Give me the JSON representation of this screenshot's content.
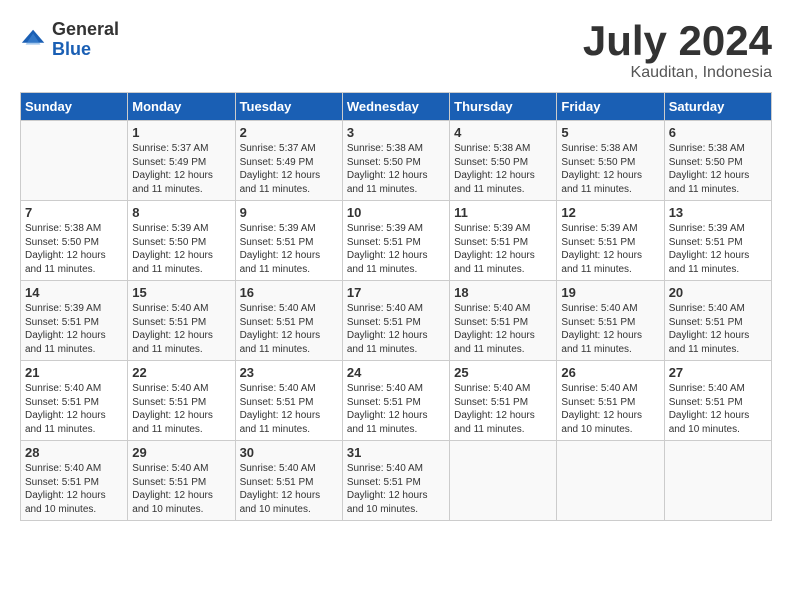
{
  "header": {
    "logo_general": "General",
    "logo_blue": "Blue",
    "month_title": "July 2024",
    "location": "Kauditan, Indonesia"
  },
  "days_of_week": [
    "Sunday",
    "Monday",
    "Tuesday",
    "Wednesday",
    "Thursday",
    "Friday",
    "Saturday"
  ],
  "weeks": [
    [
      {
        "day": "",
        "info": ""
      },
      {
        "day": "1",
        "info": "Sunrise: 5:37 AM\nSunset: 5:49 PM\nDaylight: 12 hours\nand 11 minutes."
      },
      {
        "day": "2",
        "info": "Sunrise: 5:37 AM\nSunset: 5:49 PM\nDaylight: 12 hours\nand 11 minutes."
      },
      {
        "day": "3",
        "info": "Sunrise: 5:38 AM\nSunset: 5:50 PM\nDaylight: 12 hours\nand 11 minutes."
      },
      {
        "day": "4",
        "info": "Sunrise: 5:38 AM\nSunset: 5:50 PM\nDaylight: 12 hours\nand 11 minutes."
      },
      {
        "day": "5",
        "info": "Sunrise: 5:38 AM\nSunset: 5:50 PM\nDaylight: 12 hours\nand 11 minutes."
      },
      {
        "day": "6",
        "info": "Sunrise: 5:38 AM\nSunset: 5:50 PM\nDaylight: 12 hours\nand 11 minutes."
      }
    ],
    [
      {
        "day": "7",
        "info": "Sunrise: 5:38 AM\nSunset: 5:50 PM\nDaylight: 12 hours\nand 11 minutes."
      },
      {
        "day": "8",
        "info": "Sunrise: 5:39 AM\nSunset: 5:50 PM\nDaylight: 12 hours\nand 11 minutes."
      },
      {
        "day": "9",
        "info": "Sunrise: 5:39 AM\nSunset: 5:51 PM\nDaylight: 12 hours\nand 11 minutes."
      },
      {
        "day": "10",
        "info": "Sunrise: 5:39 AM\nSunset: 5:51 PM\nDaylight: 12 hours\nand 11 minutes."
      },
      {
        "day": "11",
        "info": "Sunrise: 5:39 AM\nSunset: 5:51 PM\nDaylight: 12 hours\nand 11 minutes."
      },
      {
        "day": "12",
        "info": "Sunrise: 5:39 AM\nSunset: 5:51 PM\nDaylight: 12 hours\nand 11 minutes."
      },
      {
        "day": "13",
        "info": "Sunrise: 5:39 AM\nSunset: 5:51 PM\nDaylight: 12 hours\nand 11 minutes."
      }
    ],
    [
      {
        "day": "14",
        "info": "Sunrise: 5:39 AM\nSunset: 5:51 PM\nDaylight: 12 hours\nand 11 minutes."
      },
      {
        "day": "15",
        "info": "Sunrise: 5:40 AM\nSunset: 5:51 PM\nDaylight: 12 hours\nand 11 minutes."
      },
      {
        "day": "16",
        "info": "Sunrise: 5:40 AM\nSunset: 5:51 PM\nDaylight: 12 hours\nand 11 minutes."
      },
      {
        "day": "17",
        "info": "Sunrise: 5:40 AM\nSunset: 5:51 PM\nDaylight: 12 hours\nand 11 minutes."
      },
      {
        "day": "18",
        "info": "Sunrise: 5:40 AM\nSunset: 5:51 PM\nDaylight: 12 hours\nand 11 minutes."
      },
      {
        "day": "19",
        "info": "Sunrise: 5:40 AM\nSunset: 5:51 PM\nDaylight: 12 hours\nand 11 minutes."
      },
      {
        "day": "20",
        "info": "Sunrise: 5:40 AM\nSunset: 5:51 PM\nDaylight: 12 hours\nand 11 minutes."
      }
    ],
    [
      {
        "day": "21",
        "info": "Sunrise: 5:40 AM\nSunset: 5:51 PM\nDaylight: 12 hours\nand 11 minutes."
      },
      {
        "day": "22",
        "info": "Sunrise: 5:40 AM\nSunset: 5:51 PM\nDaylight: 12 hours\nand 11 minutes."
      },
      {
        "day": "23",
        "info": "Sunrise: 5:40 AM\nSunset: 5:51 PM\nDaylight: 12 hours\nand 11 minutes."
      },
      {
        "day": "24",
        "info": "Sunrise: 5:40 AM\nSunset: 5:51 PM\nDaylight: 12 hours\nand 11 minutes."
      },
      {
        "day": "25",
        "info": "Sunrise: 5:40 AM\nSunset: 5:51 PM\nDaylight: 12 hours\nand 11 minutes."
      },
      {
        "day": "26",
        "info": "Sunrise: 5:40 AM\nSunset: 5:51 PM\nDaylight: 12 hours\nand 10 minutes."
      },
      {
        "day": "27",
        "info": "Sunrise: 5:40 AM\nSunset: 5:51 PM\nDaylight: 12 hours\nand 10 minutes."
      }
    ],
    [
      {
        "day": "28",
        "info": "Sunrise: 5:40 AM\nSunset: 5:51 PM\nDaylight: 12 hours\nand 10 minutes."
      },
      {
        "day": "29",
        "info": "Sunrise: 5:40 AM\nSunset: 5:51 PM\nDaylight: 12 hours\nand 10 minutes."
      },
      {
        "day": "30",
        "info": "Sunrise: 5:40 AM\nSunset: 5:51 PM\nDaylight: 12 hours\nand 10 minutes."
      },
      {
        "day": "31",
        "info": "Sunrise: 5:40 AM\nSunset: 5:51 PM\nDaylight: 12 hours\nand 10 minutes."
      },
      {
        "day": "",
        "info": ""
      },
      {
        "day": "",
        "info": ""
      },
      {
        "day": "",
        "info": ""
      }
    ]
  ]
}
